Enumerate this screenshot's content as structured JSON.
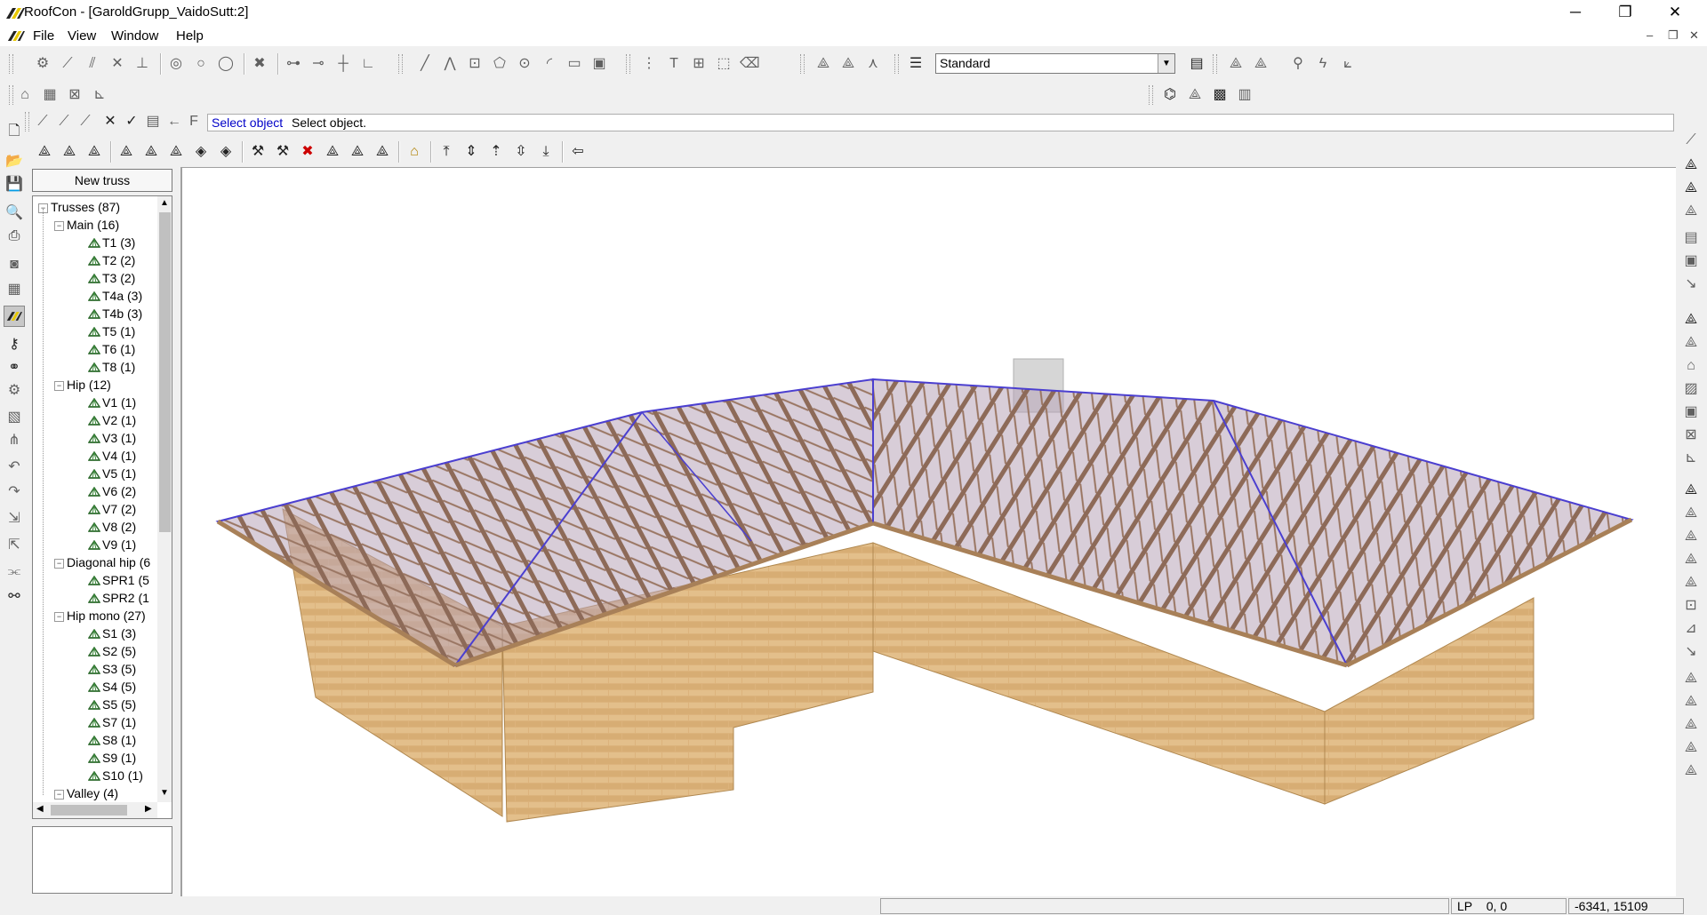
{
  "window": {
    "title": "RoofCon - [GaroldGrupp_VaidoSutt:2]",
    "minimize": "─",
    "maximize": "❐",
    "close": "✕"
  },
  "menu": {
    "items": [
      "File",
      "View",
      "Window",
      "Help"
    ],
    "mdi_minimize": "‒",
    "mdi_restore": "❐",
    "mdi_close": "✕"
  },
  "toolbar": {
    "style_select_value": "Standard"
  },
  "command": {
    "prompt": "Select object",
    "message": "Select object."
  },
  "tree": {
    "new_truss_label": "New truss",
    "root": "Trusses (87)",
    "groups": [
      {
        "label": "Main (16)",
        "items": [
          "T1 (3)",
          "T2 (2)",
          "T3 (2)",
          "T4a (3)",
          "T4b (3)",
          "T5 (1)",
          "T6 (1)",
          "T8 (1)"
        ]
      },
      {
        "label": "Hip (12)",
        "items": [
          "V1 (1)",
          "V2 (1)",
          "V3 (1)",
          "V4 (1)",
          "V5 (1)",
          "V6 (2)",
          "V7 (2)",
          "V8 (2)",
          "V9 (1)"
        ]
      },
      {
        "label": "Diagonal hip (6",
        "items": [
          "SPR1 (5",
          "SPR2 (1"
        ]
      },
      {
        "label": "Hip mono (27)",
        "items": [
          "S1 (3)",
          "S2 (5)",
          "S3 (5)",
          "S4 (5)",
          "S5 (5)",
          "S7 (1)",
          "S8 (1)",
          "S9 (1)",
          "S10 (1)"
        ]
      },
      {
        "label": "Valley (4)",
        "items": []
      }
    ]
  },
  "status": {
    "layer": "LP",
    "coords_a": "0,  0",
    "coords_b": "-6341,  15109"
  },
  "colors": {
    "roof_outline": "#4b3fd0",
    "brick": "#d9b07a",
    "timber": "#8a6a58",
    "command_prompt": "#0000c8"
  }
}
